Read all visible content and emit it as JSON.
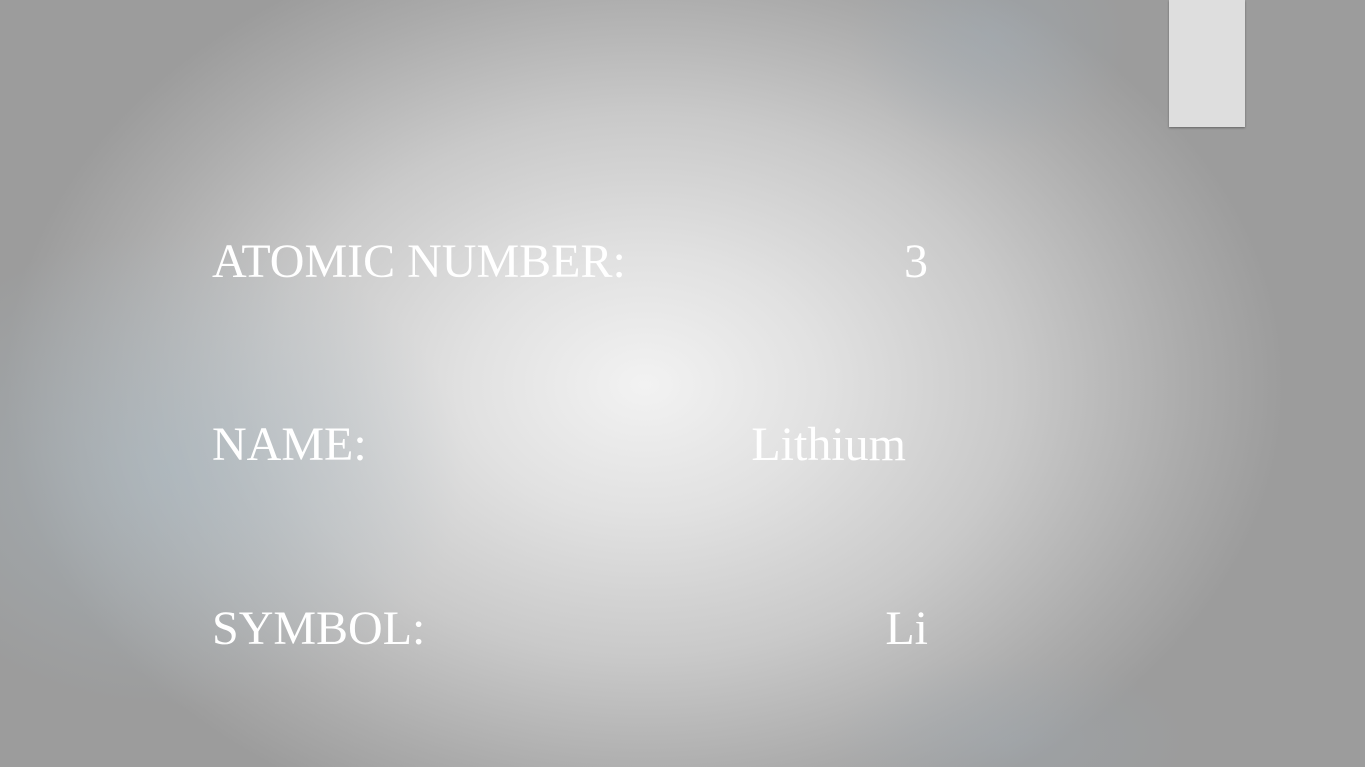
{
  "slide": {
    "rows": [
      {
        "label": "ATOMIC NUMBER:",
        "value": "3"
      },
      {
        "label": "NAME:",
        "value": "Lithium"
      },
      {
        "label": "SYMBOL:",
        "value": "Li"
      }
    ]
  }
}
